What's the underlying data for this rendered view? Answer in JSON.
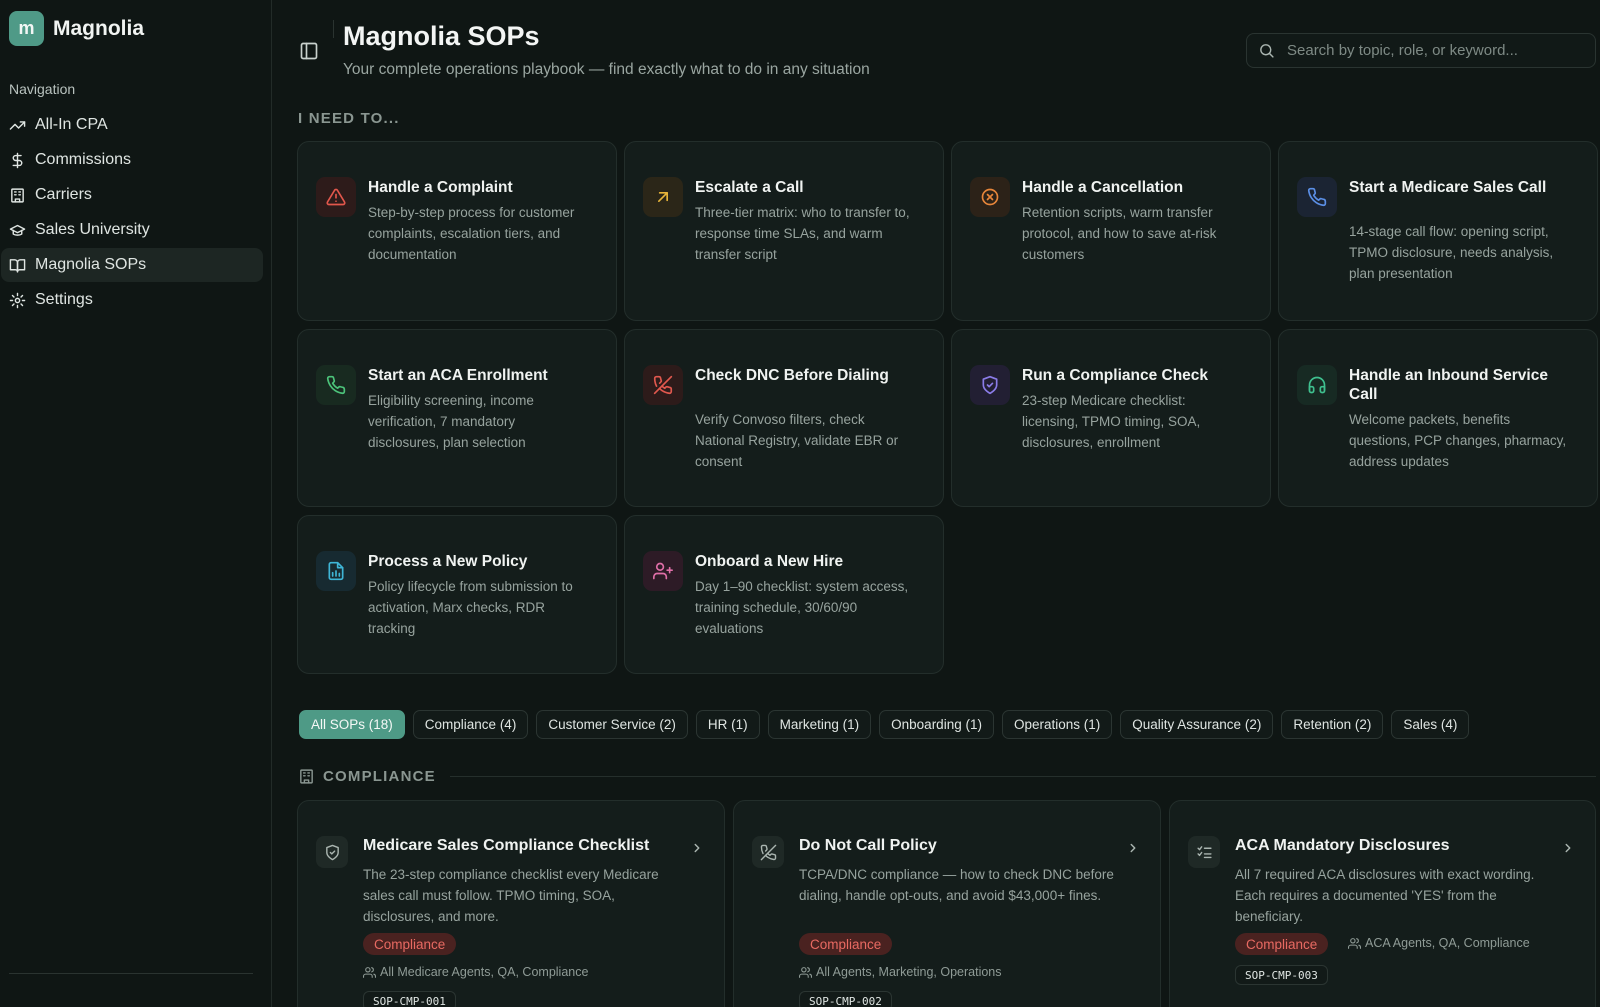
{
  "app": {
    "logo_letter": "m",
    "name": "Magnolia"
  },
  "sidebar": {
    "heading": "Navigation",
    "items": [
      {
        "label": "All-In CPA",
        "icon": "trending-up-icon"
      },
      {
        "label": "Commissions",
        "icon": "dollar-icon"
      },
      {
        "label": "Carriers",
        "icon": "building-icon"
      },
      {
        "label": "Sales University",
        "icon": "graduation-cap-icon"
      },
      {
        "label": "Magnolia SOPs",
        "icon": "book-icon",
        "active": true
      },
      {
        "label": "Settings",
        "icon": "gear-icon"
      }
    ]
  },
  "header": {
    "title": "Magnolia SOPs",
    "subtitle": "Your complete operations playbook — find exactly what to do in any situation",
    "search_placeholder": "Search by topic, role, or keyword..."
  },
  "need_section": {
    "heading": "I NEED TO...",
    "cards": [
      {
        "title": "Handle a Complaint",
        "desc": "Step-by-step process for customer complaints, escalation tiers, and documentation",
        "icon": "alert-triangle-icon",
        "color": "#e2574c"
      },
      {
        "title": "Escalate a Call",
        "desc": "Three-tier matrix: who to transfer to, response time SLAs, and warm transfer script",
        "icon": "arrow-up-right-icon",
        "color": "#e8b53a"
      },
      {
        "title": "Handle a Cancellation",
        "desc": "Retention scripts, warm transfer protocol, and how to save at-risk customers",
        "icon": "x-circle-icon",
        "color": "#e8863a"
      },
      {
        "title": "Start a Medicare Sales Call",
        "desc": "14-stage call flow: opening script, TPMO disclosure, needs analysis, plan presentation",
        "icon": "phone-icon",
        "color": "#5b8fe6"
      },
      {
        "title": "Start an ACA Enrollment",
        "desc": "Eligibility screening, income verification, 7 mandatory disclosures, plan selection",
        "icon": "phone-icon",
        "color": "#4cc37a"
      },
      {
        "title": "Check DNC Before Dialing",
        "desc": "Verify Convoso filters, check National Registry, validate EBR or consent",
        "icon": "phone-off-icon",
        "color": "#e0584e"
      },
      {
        "title": "Run a Compliance Check",
        "desc": "23-step Medicare checklist: licensing, TPMO timing, SOA, disclosures, enrollment",
        "icon": "shield-check-icon",
        "color": "#8b7ce8"
      },
      {
        "title": "Handle an Inbound Service Call",
        "desc": "Welcome packets, benefits questions, PCP changes, pharmacy, address updates",
        "icon": "headphones-icon",
        "color": "#3fc08f"
      },
      {
        "title": "Process a New Policy",
        "desc": "Policy lifecycle from submission to activation, Marx checks, RDR tracking",
        "icon": "file-chart-icon",
        "color": "#3fb5d6"
      },
      {
        "title": "Onboard a New Hire",
        "desc": "Day 1–90 checklist: system access, training schedule, 30/60/90 evaluations",
        "icon": "user-plus-icon",
        "color": "#e06fa8"
      }
    ]
  },
  "filters": [
    {
      "label": "All SOPs (18)",
      "active": true
    },
    {
      "label": "Compliance (4)"
    },
    {
      "label": "Customer Service (2)"
    },
    {
      "label": "HR (1)"
    },
    {
      "label": "Marketing (1)"
    },
    {
      "label": "Onboarding (1)"
    },
    {
      "label": "Operations (1)"
    },
    {
      "label": "Quality Assurance (2)"
    },
    {
      "label": "Retention (2)"
    },
    {
      "label": "Sales (4)"
    }
  ],
  "compliance": {
    "heading": "COMPLIANCE",
    "sops": [
      {
        "title": "Medicare Sales Compliance Checklist",
        "desc": "The 23-step compliance checklist every Medicare sales call must follow. TPMO timing, SOA, disclosures, and more.",
        "badge": "Compliance",
        "audience": "All Medicare Agents, QA, Compliance",
        "code": "SOP-CMP-001",
        "icon": "shield-check-icon"
      },
      {
        "title": "Do Not Call Policy",
        "desc": "TCPA/DNC compliance — how to check DNC before dialing, handle opt-outs, and avoid $43,000+ fines.",
        "badge": "Compliance",
        "audience": "All Agents, Marketing, Operations",
        "code": "SOP-CMP-002",
        "icon": "phone-off-icon"
      },
      {
        "title": "ACA Mandatory Disclosures",
        "desc": "All 7 required ACA disclosures with exact wording. Each requires a documented 'YES' from the beneficiary.",
        "badge": "Compliance",
        "audience": "ACA Agents, QA, Compliance",
        "code": "SOP-CMP-003",
        "icon": "list-checks-icon"
      }
    ]
  }
}
